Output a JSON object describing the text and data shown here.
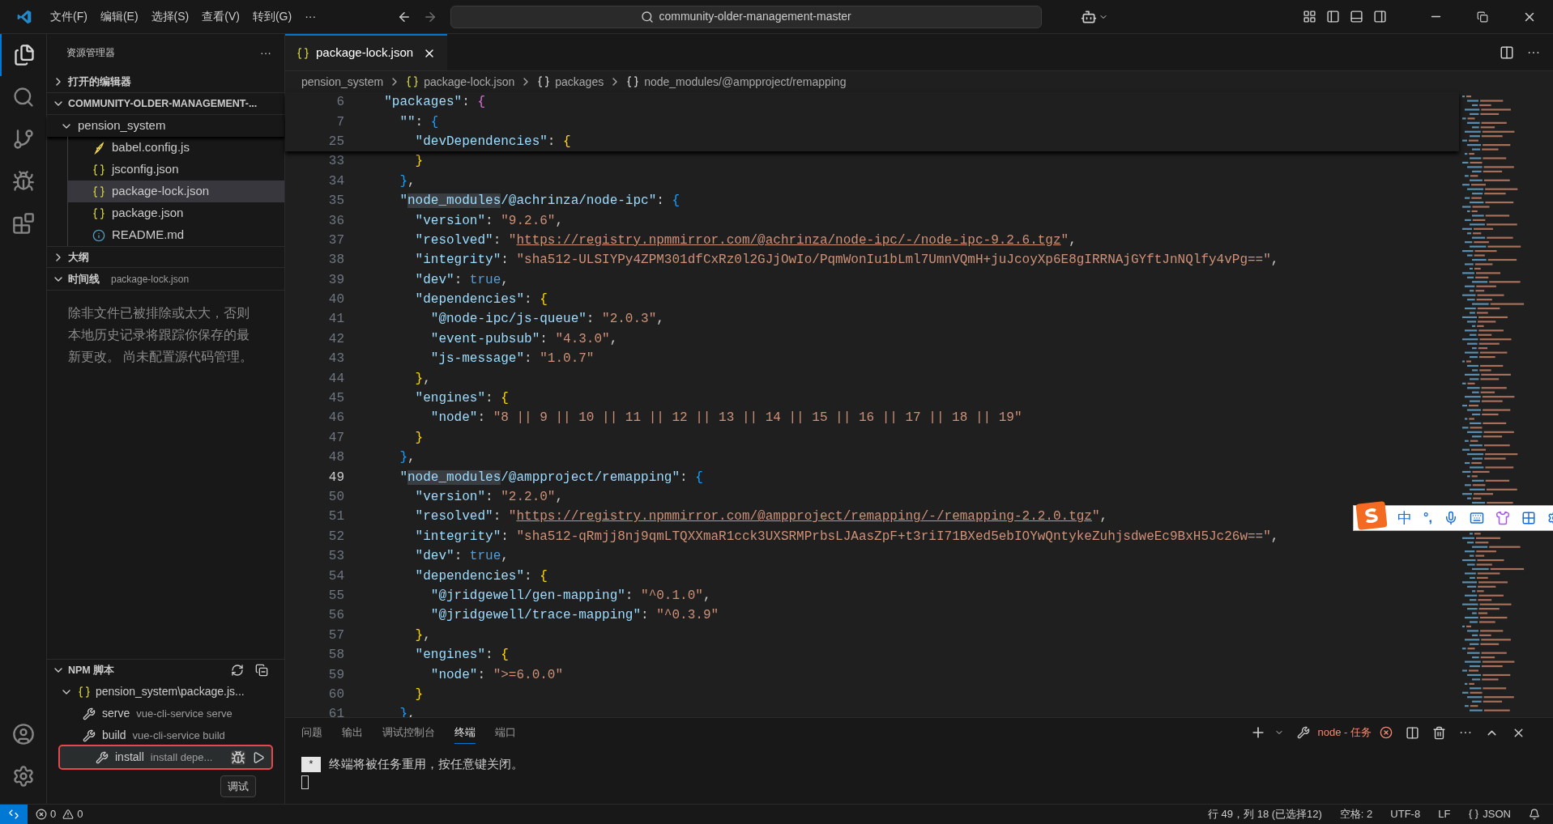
{
  "title_bar": {
    "menus": [
      "文件(F)",
      "编辑(E)",
      "选择(S)",
      "查看(V)",
      "转到(G)",
      "···"
    ],
    "search": "community-older-management-master"
  },
  "sidebar": {
    "title": "资源管理器",
    "more": "···",
    "sections": [
      {
        "label": "打开的编辑器",
        "expanded": false
      },
      {
        "label": "COMMUNITY-OLDER-MANAGEMENT-...",
        "expanded": true
      }
    ],
    "folder": {
      "label": "pension_system",
      "expanded": true,
      "children": [
        {
          "label": "babel.config.js",
          "kind": "babel",
          "selected": false
        },
        {
          "label": "jsconfig.json",
          "kind": "json",
          "selected": false
        },
        {
          "label": "package-lock.json",
          "kind": "json",
          "selected": true
        },
        {
          "label": "package.json",
          "kind": "json",
          "selected": false
        },
        {
          "label": "README.md",
          "kind": "info",
          "selected": false
        }
      ]
    },
    "outline": {
      "label": "大纲",
      "expanded": false
    },
    "timeline": {
      "label": "时间线",
      "file": "package-lock.json",
      "expanded": true,
      "message": "除非文件已被排除或太大，否则本地历史记录将跟踪你保存的最新更改。 尚未配置源代码管理。"
    },
    "npm": {
      "label": "NPM 脚本",
      "expanded": true,
      "package": {
        "label": "pension_system\\package.js...",
        "expanded": true
      },
      "scripts": [
        {
          "name": "serve",
          "command": "vue-cli-service serve",
          "highlighted": false
        },
        {
          "name": "build",
          "command": "vue-cli-service build",
          "highlighted": false
        },
        {
          "name": "install",
          "command": "install depe...",
          "highlighted": true
        }
      ],
      "tooltip": "调试"
    }
  },
  "editor": {
    "tab": {
      "label": "package-lock.json",
      "selected": true
    },
    "breadcrumb": [
      "pension_system",
      "package-lock.json",
      "packages",
      "node_modules/@ampproject/remapping"
    ],
    "sticky_lines": [
      {
        "n": "6",
        "current": false,
        "tokens": [
          {
            "kind": "key",
            "text": "  \"packages\""
          },
          {
            "kind": "punct",
            "text": ": "
          },
          {
            "kind": "b2",
            "text": "{"
          }
        ]
      },
      {
        "n": "7",
        "current": false,
        "tokens": [
          {
            "kind": "key",
            "text": "    \"\""
          },
          {
            "kind": "punct",
            "text": ": "
          },
          {
            "kind": "b3",
            "text": "{"
          }
        ]
      },
      {
        "n": "25",
        "current": false,
        "tokens": [
          {
            "kind": "key",
            "text": "      \"devDependencies\""
          },
          {
            "kind": "punct",
            "text": ": "
          },
          {
            "kind": "b1",
            "text": "{"
          }
        ]
      }
    ],
    "lines": [
      {
        "n": "33",
        "current": false,
        "tokens": [
          {
            "kind": "b1",
            "text": "      }"
          }
        ]
      },
      {
        "n": "34",
        "current": false,
        "tokens": [
          {
            "kind": "b3",
            "text": "    }"
          },
          {
            "kind": "punct",
            "text": ","
          }
        ]
      },
      {
        "n": "35",
        "current": false,
        "tokens": [
          {
            "kind": "key",
            "text": "    \""
          },
          {
            "kind": "match",
            "text": "node_modules"
          },
          {
            "kind": "key",
            "text": "/@achrinza/node-ipc\""
          },
          {
            "kind": "punct",
            "text": ": "
          },
          {
            "kind": "b3",
            "text": "{"
          }
        ]
      },
      {
        "n": "36",
        "current": false,
        "tokens": [
          {
            "kind": "key",
            "text": "      \"version\""
          },
          {
            "kind": "punct",
            "text": ": "
          },
          {
            "kind": "str",
            "text": "\"9.2.6\""
          },
          {
            "kind": "punct",
            "text": ","
          }
        ]
      },
      {
        "n": "37",
        "current": false,
        "tokens": [
          {
            "kind": "key",
            "text": "      \"resolved\""
          },
          {
            "kind": "punct",
            "text": ": "
          },
          {
            "kind": "str",
            "text": "\""
          },
          {
            "kind": "link",
            "text": "https://registry.npmmirror.com/@achrinza/node-ipc/-/node-ipc-9.2.6.tgz"
          },
          {
            "kind": "str",
            "text": "\""
          },
          {
            "kind": "punct",
            "text": ","
          }
        ]
      },
      {
        "n": "38",
        "current": false,
        "tokens": [
          {
            "kind": "key",
            "text": "      \"integrity\""
          },
          {
            "kind": "punct",
            "text": ": "
          },
          {
            "kind": "str",
            "text": "\"sha512-ULSIYPy4ZPM301dfCxRz0l2GJjOwIo/PqmWonIu1bLml7UmnVQmH+juJcoyXp6E8gIRRNAjGYftJnNQlfy4vPg==\""
          },
          {
            "kind": "punct",
            "text": ","
          }
        ]
      },
      {
        "n": "39",
        "current": false,
        "tokens": [
          {
            "kind": "key",
            "text": "      \"dev\""
          },
          {
            "kind": "punct",
            "text": ": "
          },
          {
            "kind": "bool",
            "text": "true"
          },
          {
            "kind": "punct",
            "text": ","
          }
        ]
      },
      {
        "n": "40",
        "current": false,
        "tokens": [
          {
            "kind": "key",
            "text": "      \"dependencies\""
          },
          {
            "kind": "punct",
            "text": ": "
          },
          {
            "kind": "b1",
            "text": "{"
          }
        ]
      },
      {
        "n": "41",
        "current": false,
        "tokens": [
          {
            "kind": "key",
            "text": "        \"@node-ipc/js-queue\""
          },
          {
            "kind": "punct",
            "text": ": "
          },
          {
            "kind": "str",
            "text": "\"2.0.3\""
          },
          {
            "kind": "punct",
            "text": ","
          }
        ]
      },
      {
        "n": "42",
        "current": false,
        "tokens": [
          {
            "kind": "key",
            "text": "        \"event-pubsub\""
          },
          {
            "kind": "punct",
            "text": ": "
          },
          {
            "kind": "str",
            "text": "\"4.3.0\""
          },
          {
            "kind": "punct",
            "text": ","
          }
        ]
      },
      {
        "n": "43",
        "current": false,
        "tokens": [
          {
            "kind": "key",
            "text": "        \"js-message\""
          },
          {
            "kind": "punct",
            "text": ": "
          },
          {
            "kind": "str",
            "text": "\"1.0.7\""
          }
        ]
      },
      {
        "n": "44",
        "current": false,
        "tokens": [
          {
            "kind": "b1",
            "text": "      }"
          },
          {
            "kind": "punct",
            "text": ","
          }
        ]
      },
      {
        "n": "45",
        "current": false,
        "tokens": [
          {
            "kind": "key",
            "text": "      \"engines\""
          },
          {
            "kind": "punct",
            "text": ": "
          },
          {
            "kind": "b1",
            "text": "{"
          }
        ]
      },
      {
        "n": "46",
        "current": false,
        "tokens": [
          {
            "kind": "key",
            "text": "        \"node\""
          },
          {
            "kind": "punct",
            "text": ": "
          },
          {
            "kind": "str",
            "text": "\"8 || 9 || 10 || 11 || 12 || 13 || 14 || 15 || 16 || 17 || 18 || 19\""
          }
        ]
      },
      {
        "n": "47",
        "current": false,
        "tokens": [
          {
            "kind": "b1",
            "text": "      }"
          }
        ]
      },
      {
        "n": "48",
        "current": false,
        "tokens": [
          {
            "kind": "b3",
            "text": "    }"
          },
          {
            "kind": "punct",
            "text": ","
          }
        ]
      },
      {
        "n": "49",
        "current": true,
        "tokens": [
          {
            "kind": "key",
            "text": "    \""
          },
          {
            "kind": "match",
            "text": "node_modules"
          },
          {
            "kind": "key",
            "text": "/@ampproject/remapping\""
          },
          {
            "kind": "punct",
            "text": ": "
          },
          {
            "kind": "b3",
            "text": "{"
          }
        ]
      },
      {
        "n": "50",
        "current": false,
        "tokens": [
          {
            "kind": "key",
            "text": "      \"version\""
          },
          {
            "kind": "punct",
            "text": ": "
          },
          {
            "kind": "str",
            "text": "\"2.2.0\""
          },
          {
            "kind": "punct",
            "text": ","
          }
        ]
      },
      {
        "n": "51",
        "current": false,
        "tokens": [
          {
            "kind": "key",
            "text": "      \"resolved\""
          },
          {
            "kind": "punct",
            "text": ": "
          },
          {
            "kind": "str",
            "text": "\""
          },
          {
            "kind": "link",
            "text": "https://registry.npmmirror.com/@ampproject/remapping/-/remapping-2.2.0.tgz"
          },
          {
            "kind": "str",
            "text": "\""
          },
          {
            "kind": "punct",
            "text": ","
          }
        ]
      },
      {
        "n": "52",
        "current": false,
        "tokens": [
          {
            "kind": "key",
            "text": "      \"integrity\""
          },
          {
            "kind": "punct",
            "text": ": "
          },
          {
            "kind": "str",
            "text": "\"sha512-qRmjj8nj9qmLTQXXmaR1cck3UXSRMPrbsLJAasZpF+t3riI71BXed5ebIOYwQntykeZuhjsdweEc9BxH5Jc26w==\""
          },
          {
            "kind": "punct",
            "text": ","
          }
        ]
      },
      {
        "n": "53",
        "current": false,
        "tokens": [
          {
            "kind": "key",
            "text": "      \"dev\""
          },
          {
            "kind": "punct",
            "text": ": "
          },
          {
            "kind": "bool",
            "text": "true"
          },
          {
            "kind": "punct",
            "text": ","
          }
        ]
      },
      {
        "n": "54",
        "current": false,
        "tokens": [
          {
            "kind": "key",
            "text": "      \"dependencies\""
          },
          {
            "kind": "punct",
            "text": ": "
          },
          {
            "kind": "b1",
            "text": "{"
          }
        ]
      },
      {
        "n": "55",
        "current": false,
        "tokens": [
          {
            "kind": "key",
            "text": "        \"@jridgewell/gen-mapping\""
          },
          {
            "kind": "punct",
            "text": ": "
          },
          {
            "kind": "str",
            "text": "\"^0.1.0\""
          },
          {
            "kind": "punct",
            "text": ","
          }
        ]
      },
      {
        "n": "56",
        "current": false,
        "tokens": [
          {
            "kind": "key",
            "text": "        \"@jridgewell/trace-mapping\""
          },
          {
            "kind": "punct",
            "text": ": "
          },
          {
            "kind": "str",
            "text": "\"^0.3.9\""
          }
        ]
      },
      {
        "n": "57",
        "current": false,
        "tokens": [
          {
            "kind": "b1",
            "text": "      }"
          },
          {
            "kind": "punct",
            "text": ","
          }
        ]
      },
      {
        "n": "58",
        "current": false,
        "tokens": [
          {
            "kind": "key",
            "text": "      \"engines\""
          },
          {
            "kind": "punct",
            "text": ": "
          },
          {
            "kind": "b1",
            "text": "{"
          }
        ]
      },
      {
        "n": "59",
        "current": false,
        "tokens": [
          {
            "kind": "key",
            "text": "        \"node\""
          },
          {
            "kind": "punct",
            "text": ": "
          },
          {
            "kind": "str",
            "text": "\">=6.0.0\""
          }
        ]
      },
      {
        "n": "60",
        "current": false,
        "tokens": [
          {
            "kind": "b1",
            "text": "      }"
          }
        ]
      },
      {
        "n": "61",
        "current": false,
        "tokens": [
          {
            "kind": "b3",
            "text": "    }"
          },
          {
            "kind": "punct",
            "text": ","
          }
        ]
      }
    ]
  },
  "panel": {
    "tabs": [
      {
        "label": "问题",
        "selected": false
      },
      {
        "label": "输出",
        "selected": false
      },
      {
        "label": "调试控制台",
        "selected": false
      },
      {
        "label": "终端",
        "selected": true
      },
      {
        "label": "端口",
        "selected": false
      }
    ],
    "task": "node - 任务",
    "terminal_badge": "*",
    "terminal_text": "终端将被任务重用，按任意键关闭。"
  },
  "ime_toolbar": {
    "mode": "中",
    "punctuation": "°,"
  },
  "status_bar": {
    "errors": "0",
    "warnings": "0",
    "position": "行 49，列 18 (已选择12)",
    "indent": "空格: 2",
    "encoding": "UTF-8",
    "eol": "LF",
    "language": "JSON"
  }
}
